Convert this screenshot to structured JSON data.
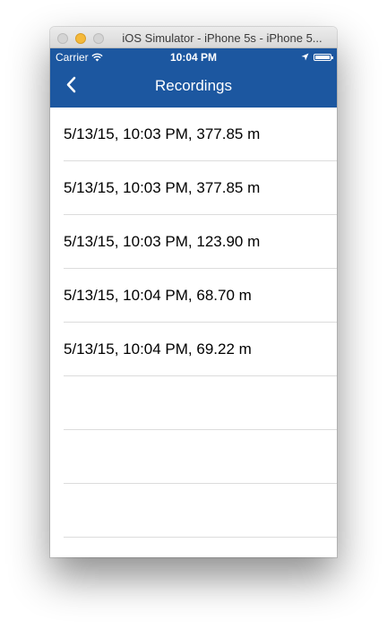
{
  "window": {
    "title": "iOS Simulator - iPhone 5s - iPhone 5..."
  },
  "status_bar": {
    "carrier": "Carrier",
    "time": "10:04 PM",
    "battery_level": 1.0
  },
  "nav": {
    "title": "Recordings",
    "back_icon": "chevron-left-icon"
  },
  "recordings": [
    "5/13/15, 10:03 PM, 377.85 m",
    "5/13/15, 10:03 PM, 377.85 m",
    "5/13/15, 10:03 PM, 123.90 m",
    "5/13/15, 10:04 PM, 68.70 m",
    "5/13/15, 10:04 PM, 69.22 m",
    "",
    "",
    "",
    ""
  ],
  "colors": {
    "nav_background": "#1c57a0",
    "separator": "#dcdcdc"
  }
}
